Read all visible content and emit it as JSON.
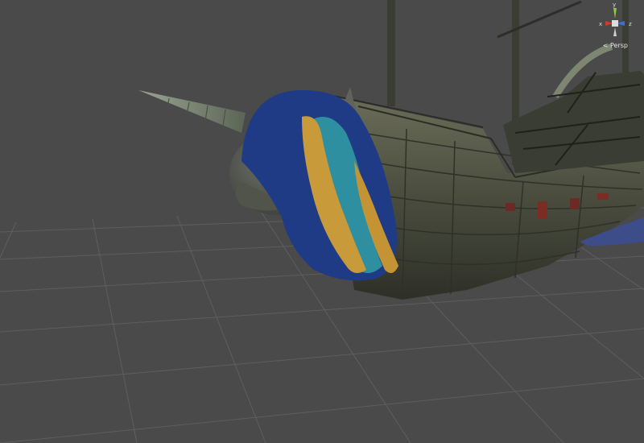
{
  "viewport": {
    "background_color": "#4a4a4a",
    "grid_color": "#5c5c5c"
  },
  "scene_gizmo": {
    "projection_label": "< Persp",
    "axes": {
      "x_label": "x",
      "y_label": "y",
      "z_label": "z"
    },
    "axis_colors": {
      "x": "#d23a2a",
      "y": "#8fce3a",
      "z": "#3a6fd8"
    }
  },
  "model": {
    "icon": "sailing-ship-model",
    "figurehead": "unicorn-figurehead",
    "mane_colors": [
      "#1d3d8a",
      "#2f8f9e",
      "#c99a3a"
    ]
  }
}
